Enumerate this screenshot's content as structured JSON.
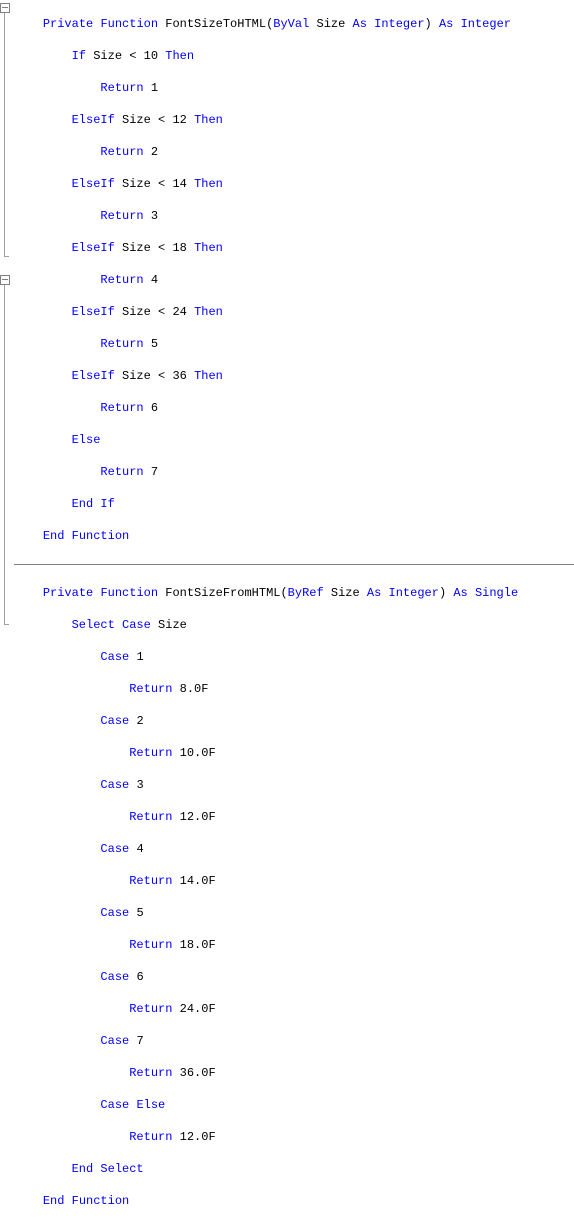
{
  "func1": {
    "decl_private": "Private",
    "decl_function": "Function",
    "name": "FontSizeToHTML",
    "param_byval": "ByVal",
    "param_name": "Size",
    "as1": "As",
    "param_type": "Integer",
    "as2": "As",
    "ret_type": "Integer",
    "kw_if": "If",
    "kw_elseif": "ElseIf",
    "kw_else": "Else",
    "kw_then": "Then",
    "kw_return": "Return",
    "kw_endif": "End",
    "kw_endif2": "If",
    "kw_endfunc1": "End",
    "kw_endfunc2": "Function",
    "size_var": "Size",
    "lt": "<",
    "c1": "10",
    "r1": "1",
    "c2": "12",
    "r2": "2",
    "c3": "14",
    "r3": "3",
    "c4": "18",
    "r4": "4",
    "c5": "24",
    "r5": "5",
    "c6": "36",
    "r6": "6",
    "r7": "7"
  },
  "func2": {
    "decl_private": "Private",
    "decl_function": "Function",
    "name": "FontSizeFromHTML",
    "param_byref": "ByRef",
    "param_name": "Size",
    "as1": "As",
    "param_type": "Integer",
    "as2": "As",
    "ret_type": "Single",
    "kw_select": "Select",
    "kw_case": "Case",
    "kw_caseelse": "Else",
    "kw_return": "Return",
    "kw_endsel1": "End",
    "kw_endsel2": "Select",
    "kw_endfunc1": "End",
    "kw_endfunc2": "Function",
    "size_var": "Size",
    "c1": "1",
    "v1": "8.0F",
    "c2": "2",
    "v2": "10.0F",
    "c3": "3",
    "v3": "12.0F",
    "c4": "4",
    "v4": "14.0F",
    "c5": "5",
    "v5": "18.0F",
    "c6": "6",
    "v6": "24.0F",
    "c7": "7",
    "v7": "36.0F",
    "velse": "12.0F"
  }
}
